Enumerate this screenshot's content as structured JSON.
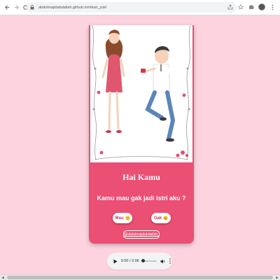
{
  "browser": {
    "url": "abdulmajidabdallah.github.io/nikah_yuk/"
  },
  "card": {
    "title": "Hai Kamu",
    "question": "Kamu mau gak jadi istri aku ?",
    "yes_label": "Mau",
    "no_label": "Gak",
    "credit": "@abdulmajidabdallah_"
  },
  "audio": {
    "time": "0:00 / 2:06"
  },
  "colors": {
    "page_background": "#fcd3de",
    "card": "#ec4f74",
    "button": "#ffffff"
  },
  "icons": {
    "back": "back-arrow-icon",
    "forward": "forward-arrow-icon",
    "reload": "reload-icon",
    "lock": "lock-icon",
    "share": "share-icon",
    "bookmark": "star-icon",
    "extensions": "puzzle-icon",
    "profile": "avatar",
    "menu": "kebab-menu-icon",
    "play": "play-icon",
    "volume": "volume-icon"
  }
}
